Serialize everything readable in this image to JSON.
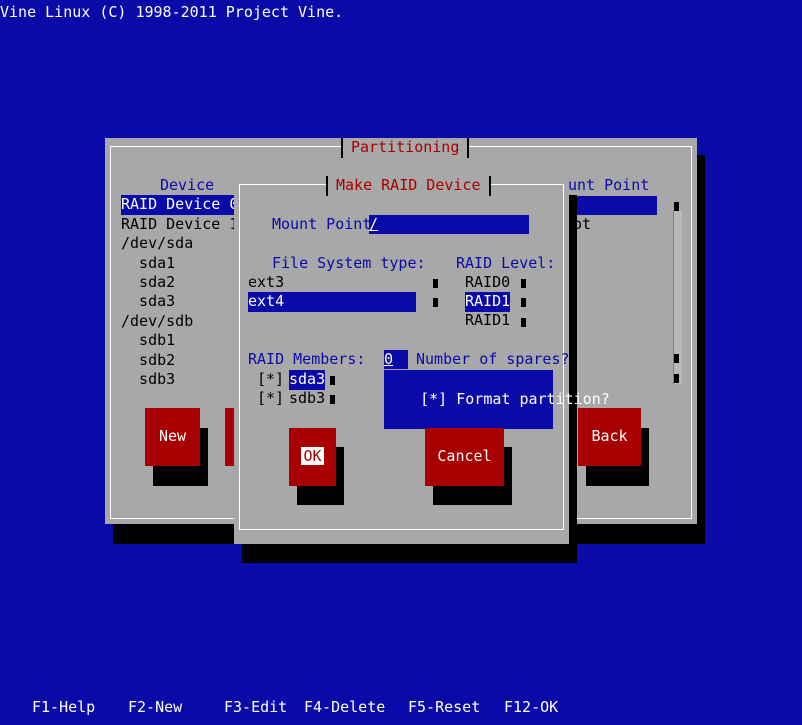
{
  "header": "Vine Linux (C) 1998-2011 Project Vine.",
  "partitioning": {
    "title": "Partitioning",
    "device_header": "Device",
    "mount_header": "unt Point",
    "devices": [
      "RAID Device 0",
      "RAID Device 1",
      "/dev/sda",
      "  sda1",
      "  sda2",
      "  sda3",
      "/dev/sdb",
      "  sdb1",
      "  sdb2",
      "  sdb3"
    ],
    "mount_row2": "ot",
    "buttons": {
      "new": "New",
      "back": "Back"
    }
  },
  "raid_dialog": {
    "title": "Make RAID Device",
    "mount_point_label": "Mount Point:",
    "mount_point_value": "/",
    "fs_type_label": "File System type:",
    "fs_types": [
      "ext3",
      "ext4"
    ],
    "raid_level_label": "RAID Level:",
    "raid_levels": [
      "RAID0",
      "RAID1",
      "RAID1"
    ],
    "raid_members_label": "RAID Members:",
    "members": [
      {
        "check": "[*]",
        "name": "sda3"
      },
      {
        "check": "[*]",
        "name": "sdb3"
      }
    ],
    "spares_value": "0",
    "spares_label": "Number of spares?",
    "format_check": "[*]",
    "format_label": "Format partition?",
    "ok_label": "OK",
    "cancel_label": "Cancel"
  },
  "function_keys": [
    "F1-Help",
    "F2-New",
    "F3-Edit",
    "F4-Delete",
    "F5-Reset",
    "F12-OK"
  ]
}
